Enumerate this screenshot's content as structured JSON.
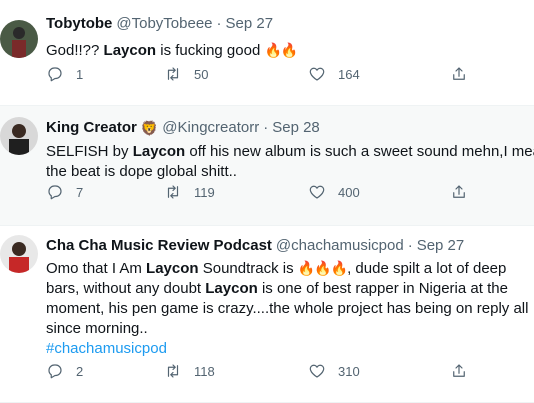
{
  "tweets": [
    {
      "name": "Tobytobe",
      "emoji": "",
      "handle": "@TobyTobeee",
      "dot": "·",
      "time": "Sep 27",
      "lines": [
        [
          {
            "t": "God!!?? "
          },
          {
            "t": "Laycon",
            "b": true
          },
          {
            "t": " is fucking good "
          },
          {
            "t": "🔥🔥",
            "fire": true
          }
        ]
      ],
      "replies": "1",
      "retweets": "50",
      "likes": "164"
    },
    {
      "name": "King Creator",
      "emoji": "🦁",
      "handle": "@Kingcreatorr",
      "dot": "·",
      "time": "Sep 28",
      "lines": [
        [
          {
            "t": "SELFISH by "
          },
          {
            "t": "Laycon",
            "b": true
          },
          {
            "t": " off his new album is such a sweet sound mehn,I mean"
          }
        ],
        [
          {
            "t": "the beat is dope global shitt.."
          }
        ]
      ],
      "replies": "7",
      "retweets": "119",
      "likes": "400"
    },
    {
      "name": "Cha Cha Music Review Podcast",
      "emoji": "",
      "handle": "@chachamusicpod",
      "dot": "·",
      "time": "Sep 27",
      "lines": [
        [
          {
            "t": "Omo that I Am "
          },
          {
            "t": "Laycon",
            "b": true
          },
          {
            "t": " Soundtrack is "
          },
          {
            "t": "🔥🔥🔥",
            "fire": true
          },
          {
            "t": ", dude spilt a lot of deep"
          }
        ],
        [
          {
            "t": "bars, without any doubt "
          },
          {
            "t": "Laycon",
            "b": true
          },
          {
            "t": " is one of best rapper in Nigeria at the"
          }
        ],
        [
          {
            "t": "moment, his pen game is crazy....the whole project has being on reply all"
          }
        ],
        [
          {
            "t": "since morning.."
          }
        ],
        [
          {
            "t": "#chachamusicpod",
            "tag": true
          }
        ]
      ],
      "replies": "2",
      "retweets": "118",
      "likes": "310"
    }
  ],
  "colors": {
    "text": "#0f1419",
    "muted": "#536471",
    "link": "#1d9bf0",
    "highlight_bg": "#f7f9f9",
    "divider": "#eff3f4"
  },
  "icons": {
    "reply": "reply-icon",
    "retweet": "retweet-icon",
    "like": "heart-icon",
    "share": "share-icon"
  }
}
